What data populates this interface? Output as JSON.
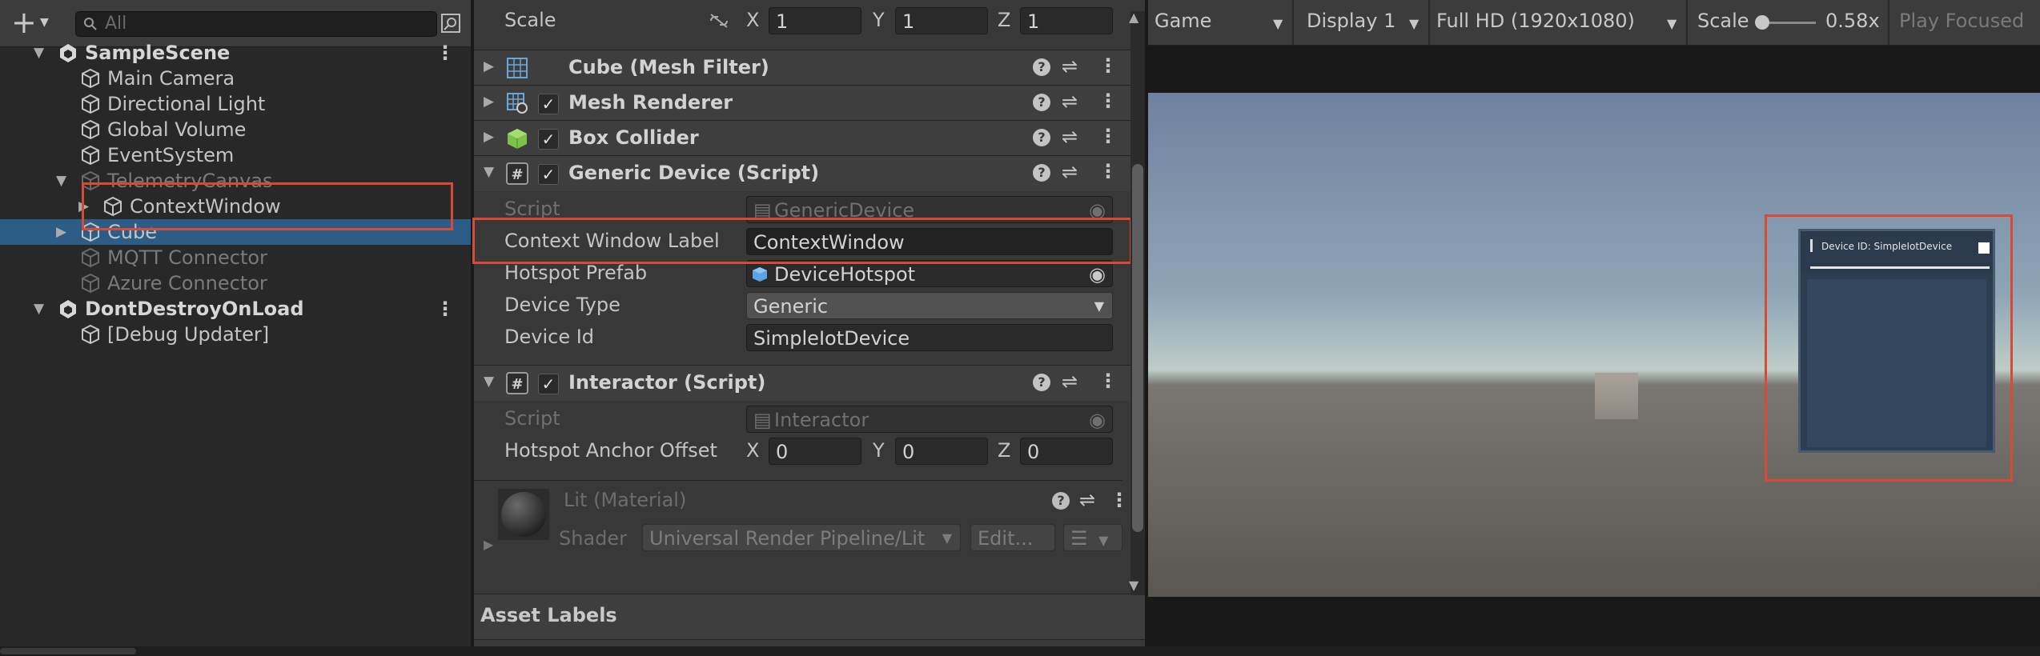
{
  "hierarchy": {
    "search_placeholder": "All",
    "rows": [
      {
        "label": "SampleScene",
        "indent": 0,
        "bold": true,
        "expand": "open",
        "unity": true,
        "menu": true
      },
      {
        "label": "Main Camera",
        "indent": 1
      },
      {
        "label": "Directional Light",
        "indent": 1
      },
      {
        "label": "Global Volume",
        "indent": 1
      },
      {
        "label": "EventSystem",
        "indent": 1
      },
      {
        "label": "TelemetryCanvas",
        "indent": 1,
        "expand": "open",
        "dim": true
      },
      {
        "label": "ContextWindow",
        "indent": 2,
        "expand": "closed"
      },
      {
        "label": "Cube",
        "indent": 1,
        "selected": true,
        "expand": "closed"
      },
      {
        "label": "MQTT Connector",
        "indent": 1,
        "dim": true
      },
      {
        "label": "Azure Connector",
        "indent": 1,
        "dim": true
      },
      {
        "label": "DontDestroyOnLoad",
        "indent": 0,
        "bold": true,
        "expand": "open",
        "unity": true,
        "menu": true
      },
      {
        "label": "[Debug Updater]",
        "indent": 1
      }
    ]
  },
  "inspector": {
    "scale": {
      "label": "Scale",
      "x": "1",
      "y": "1",
      "z": "1"
    },
    "axes": {
      "x": "X",
      "y": "Y",
      "z": "Z"
    },
    "components": {
      "mesh_filter": "Cube (Mesh Filter)",
      "mesh_renderer": "Mesh Renderer",
      "box_collider": "Box Collider",
      "generic_device": "Generic Device (Script)",
      "interactor": "Interactor (Script)"
    },
    "generic_device": {
      "script_label": "Script",
      "script_value": "GenericDevice",
      "context_label": "Context Window Label",
      "context_value": "ContextWindow",
      "hotspot_label": "Hotspot Prefab",
      "hotspot_value": "DeviceHotspot",
      "type_label": "Device Type",
      "type_value": "Generic",
      "id_label": "Device Id",
      "id_value": "SimpleIotDevice"
    },
    "interactor": {
      "script_label": "Script",
      "script_value": "Interactor",
      "offset_label": "Hotspot Anchor Offset",
      "x": "0",
      "y": "0",
      "z": "0"
    },
    "material": {
      "name": "Lit (Material)",
      "shader_label": "Shader",
      "shader_value": "Universal Render Pipeline/Lit",
      "edit_label": "Edit..."
    },
    "asset_labels": "Asset Labels"
  },
  "game": {
    "view": "Game",
    "display": "Display 1",
    "resolution": "Full HD (1920x1080)",
    "scale_label": "Scale",
    "scale_value": "0.58x",
    "play_focused": "Play Focused",
    "device_panel_title": "Device ID: SimpleIotDevice"
  },
  "colors": {
    "highlight": "#d94a35",
    "selection": "#2c5d87"
  }
}
